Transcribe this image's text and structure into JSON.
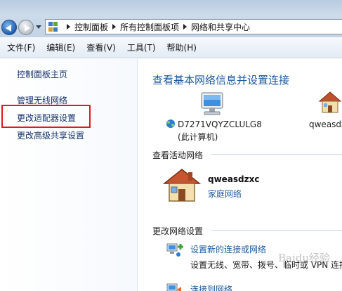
{
  "address_bar": {
    "breadcrumbs": [
      "控制面板",
      "所有控制面板项",
      "网络和共享中心"
    ]
  },
  "menu": [
    "文件(F)",
    "编辑(E)",
    "查看(V)",
    "工具(T)",
    "帮助(H)"
  ],
  "left_pane": {
    "links": [
      "控制面板主页",
      "管理无线网络",
      "更改适配器设置",
      "更改高级共享设置"
    ],
    "highlighted": "更改适配器设置",
    "highlight_color": "#e0191d"
  },
  "main": {
    "title": "查看基本网络信息并设置连接",
    "map": {
      "computer_name": "D7271VQYZCLULG8",
      "computer_sub": "(此计算机)",
      "network_name_partial": "qweasdz"
    },
    "active_networks_label": "查看活动网络",
    "active_network": {
      "name": "qweasdzxc",
      "type": "家庭网络"
    },
    "change_settings_label": "更改网络设置",
    "tasks": [
      {
        "link": "设置新的连接或网络",
        "desc": "设置无线、宽带、拨号、临时或 VPN 连接",
        "icon": "new-connection-icon"
      },
      {
        "link": "连接到网络",
        "icon": "connect-network-icon"
      }
    ]
  },
  "watermark": "Baidu经验",
  "colors": {
    "link": "#1c5a9e",
    "left_link": "#14326a",
    "title_bar": "#c3d4e6"
  }
}
